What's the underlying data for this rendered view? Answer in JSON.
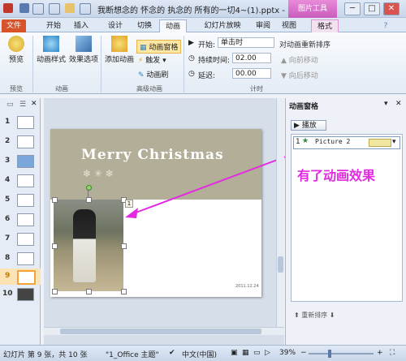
{
  "window": {
    "title": "我断想念的 怀念的 执念的 所有的一切4~(1).pptx - Micro...",
    "contextual_tab": "图片工具",
    "minimize": "─",
    "maximize": "□",
    "close": "✕"
  },
  "tabs": [
    "文件",
    "开始",
    "插入",
    "设计",
    "切换",
    "动画",
    "幻灯片放映",
    "审阅",
    "视图",
    "格式"
  ],
  "ribbon": {
    "preview": {
      "label": "预览",
      "group": "预览"
    },
    "animation": {
      "styles_label": "动画样式",
      "effects_label": "效果选项",
      "group": "动画"
    },
    "advanced": {
      "add_label": "添加动画",
      "pane_label": "动画窗格",
      "trigger_label": "触发",
      "painter_label": "动画刷",
      "group": "高级动画"
    },
    "timing": {
      "start_label": "开始:",
      "start_value": "单击时",
      "duration_label": "持续时间:",
      "duration_value": "02.00",
      "delay_label": "延迟:",
      "delay_value": "00.00",
      "group": "计时"
    },
    "reorder": {
      "title": "对动画重新排序",
      "earlier": "向前移动",
      "later": "向后移动"
    }
  },
  "slides": [
    {
      "num": "1"
    },
    {
      "num": "2"
    },
    {
      "num": "3"
    },
    {
      "num": "4"
    },
    {
      "num": "5"
    },
    {
      "num": "6"
    },
    {
      "num": "7"
    },
    {
      "num": "8"
    },
    {
      "num": "9"
    },
    {
      "num": "10"
    }
  ],
  "slide": {
    "headline": "Merry Christmas",
    "date": "2011.12.24"
  },
  "animation_pane": {
    "title": "动画窗格",
    "play_label": "播放",
    "item_num": "1",
    "item_name": "Picture 2"
  },
  "annotation": "有了动画效果",
  "statusbar": {
    "slide_info": "幻灯片 第 9 张，共 10 张",
    "theme": "\"1_Office 主题\"",
    "zoom": "39%"
  },
  "colors": {
    "file_tab": "#d9532a",
    "contextual": "#c85cbc",
    "annotation": "#e22be0",
    "selected_thumb": "#f2a43a"
  }
}
